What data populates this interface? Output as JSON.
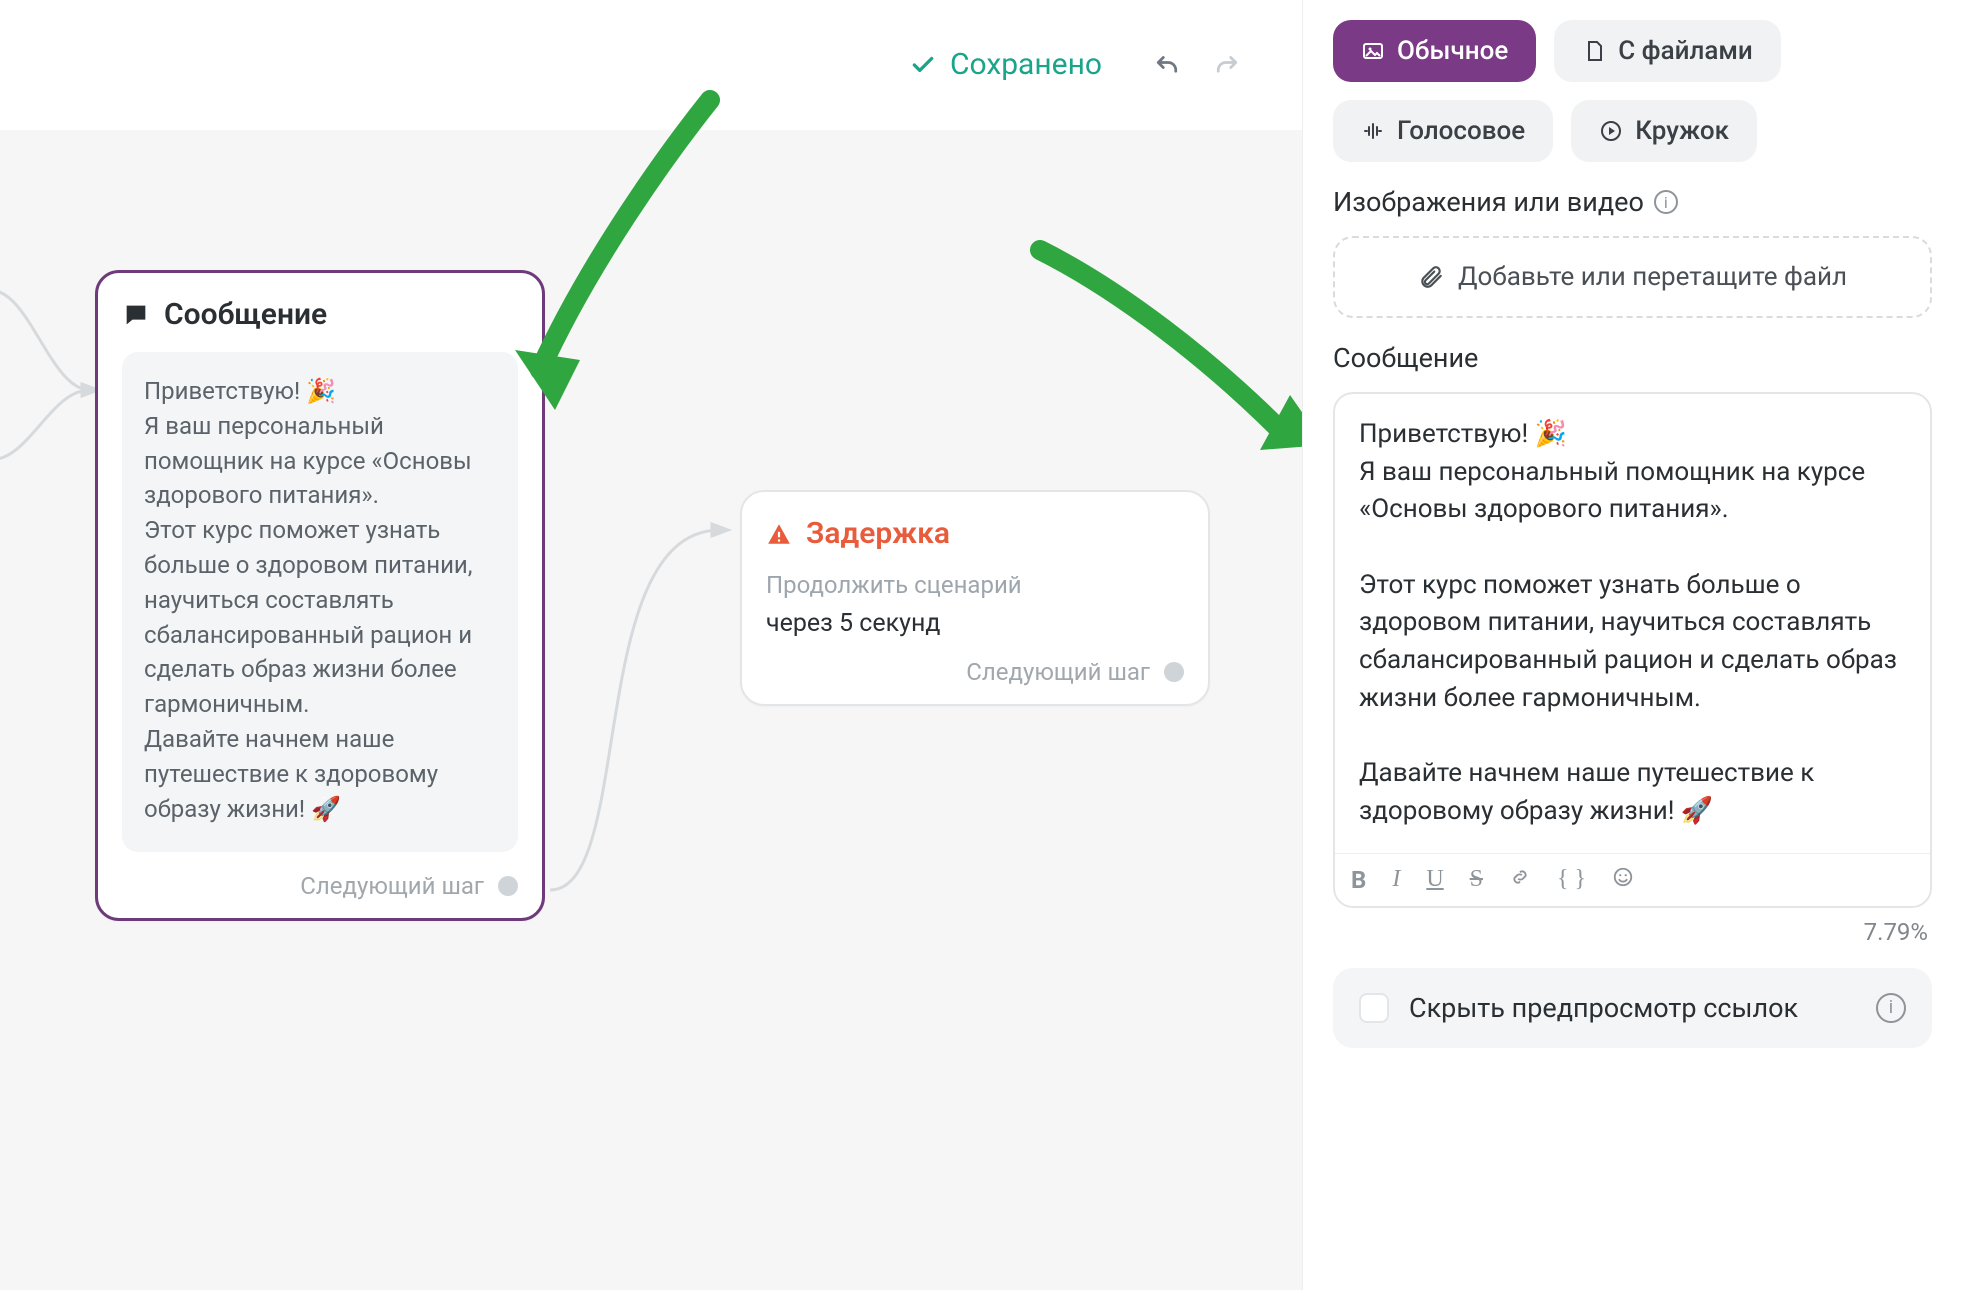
{
  "header": {
    "saved_label": "Сохранено"
  },
  "nodes": {
    "message": {
      "title": "Сообщение",
      "body": "Приветствую! 🎉\nЯ ваш персональный помощник на курсе «Основы здорового питания».\nЭтот курс поможет узнать больше о здоровом питании, научиться составлять сбалансированный рацион и сделать образ жизни более гармоничным.\nДавайте начнем наше путешествие к здоровому образу жизни! 🚀",
      "next_step": "Следующий шаг"
    },
    "delay": {
      "title": "Задержка",
      "subtitle": "Продолжить сценарий",
      "value": "через 5 секунд",
      "next_step": "Следующий шаг"
    }
  },
  "panel": {
    "chips": {
      "normal": "Обычное",
      "files": "С файлами",
      "voice": "Голосовое",
      "circle": "Кружок"
    },
    "media_label": "Изображения или видео",
    "dropzone": "Добавьте или перетащите файл",
    "message_label": "Сообщение",
    "editor_body": "Приветствую! 🎉\nЯ ваш персональный помощник на курсе «Основы здорового питания».\n\nЭтот курс поможет узнать больше о здоровом питании, научиться составлять сбалансированный рацион и сделать образ жизни более гармоничным.\n\nДавайте начнем наше путешествие к здоровому образу жизни! 🚀",
    "percent": "7.79%",
    "hide_preview": "Скрыть предпросмотр ссылок"
  }
}
